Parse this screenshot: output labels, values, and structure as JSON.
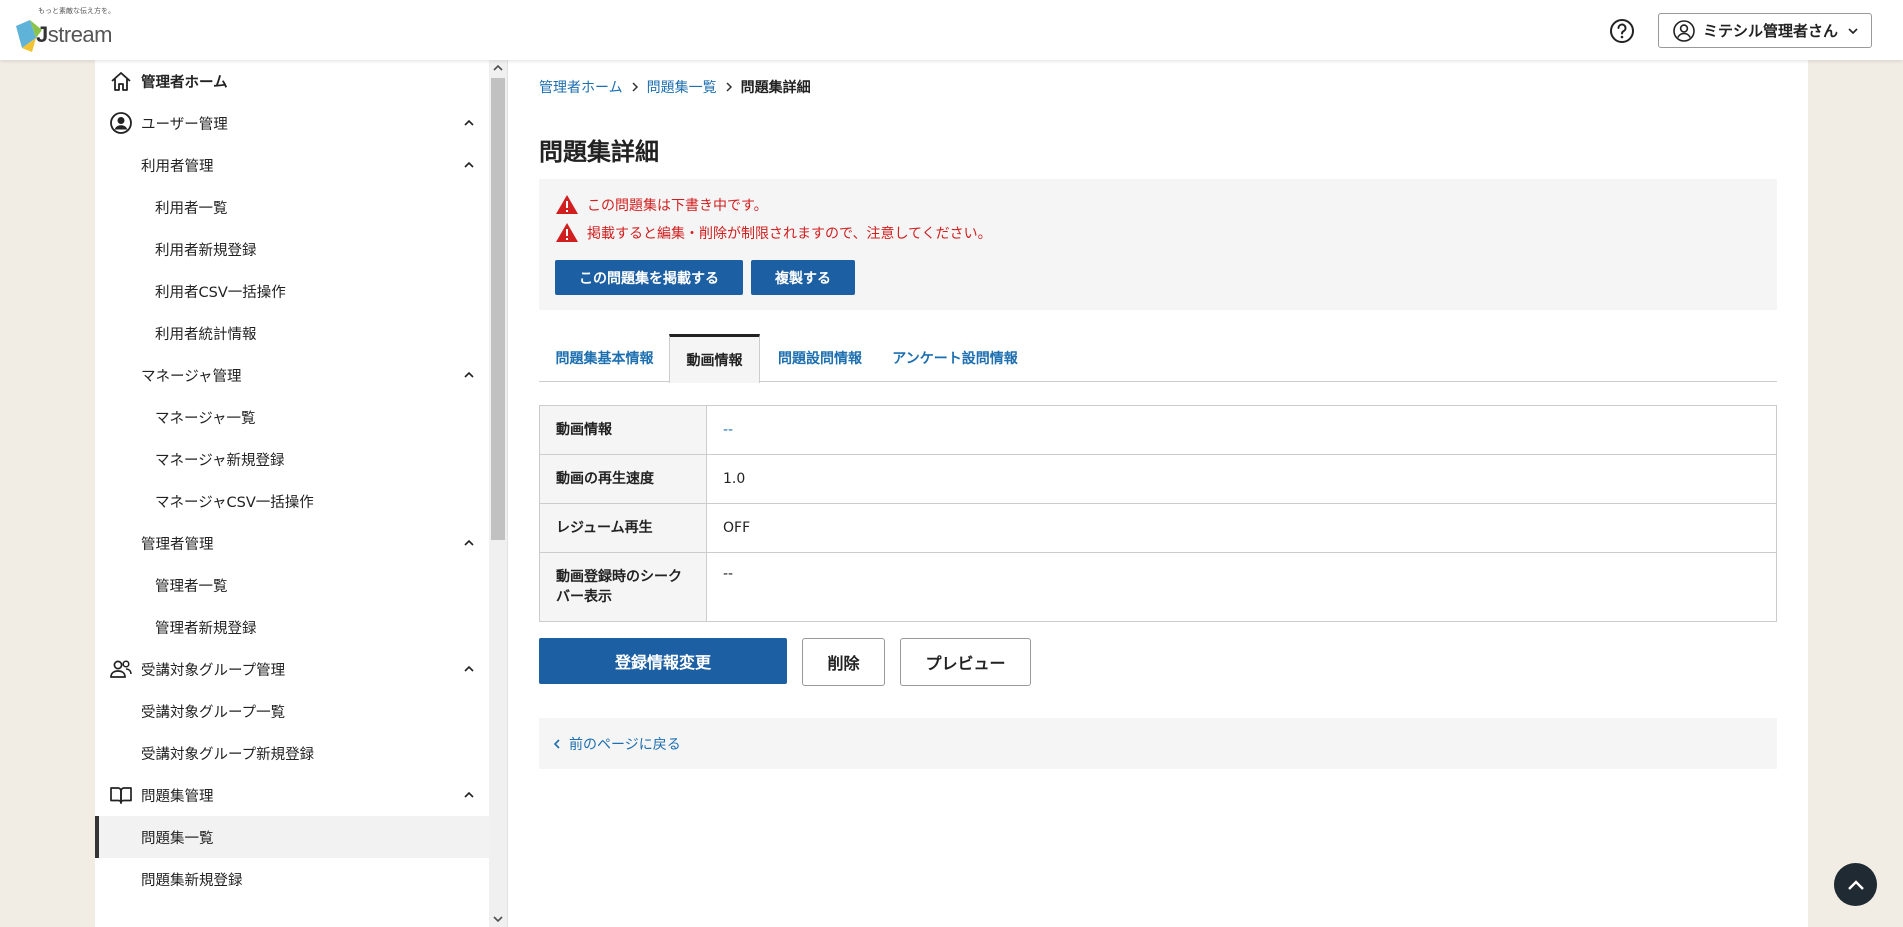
{
  "header": {
    "logo_tagline": "もっと素敵な伝え方を。",
    "logo_text": "stream",
    "logo_letter": "J",
    "user_label": "ミテシル管理者さん"
  },
  "sidebar": {
    "items": [
      {
        "label": "管理者ホーム"
      },
      {
        "label": "ユーザー管理"
      },
      {
        "label": "利用者管理"
      },
      {
        "label": "利用者一覧"
      },
      {
        "label": "利用者新規登録"
      },
      {
        "label": "利用者CSV一括操作"
      },
      {
        "label": "利用者統計情報"
      },
      {
        "label": "マネージャ管理"
      },
      {
        "label": "マネージャ一覧"
      },
      {
        "label": "マネージャ新規登録"
      },
      {
        "label": "マネージャCSV一括操作"
      },
      {
        "label": "管理者管理"
      },
      {
        "label": "管理者一覧"
      },
      {
        "label": "管理者新規登録"
      },
      {
        "label": "受講対象グループ管理"
      },
      {
        "label": "受講対象グループ一覧"
      },
      {
        "label": "受講対象グループ新規登録"
      },
      {
        "label": "問題集管理"
      },
      {
        "label": "問題集一覧"
      },
      {
        "label": "問題集新規登録"
      }
    ]
  },
  "breadcrumb": {
    "home": "管理者ホーム",
    "list": "問題集一覧",
    "current": "問題集詳細"
  },
  "page": {
    "title": "問題集詳細"
  },
  "alert": {
    "line1": "この問題集は下書き中です。",
    "line2": "掲載すると編集・削除が制限されますので、注意してください。",
    "publish_button": "この問題集を掲載する",
    "duplicate_button": "複製する"
  },
  "tabs": [
    {
      "label": "問題集基本情報"
    },
    {
      "label": "動画情報"
    },
    {
      "label": "問題設問情報"
    },
    {
      "label": "アンケート設問情報"
    }
  ],
  "table": {
    "rows": [
      {
        "label": "動画情報",
        "value": "--"
      },
      {
        "label": "動画の再生速度",
        "value": "1.0"
      },
      {
        "label": "レジューム再生",
        "value": "OFF"
      },
      {
        "label": "動画登録時のシークバー表示",
        "value": "--"
      }
    ]
  },
  "actions": {
    "edit": "登録情報変更",
    "delete": "削除",
    "preview": "プレビュー",
    "back": "前のページに戻る"
  },
  "colors": {
    "primary": "#1d5fa3",
    "link": "#1d6fb0",
    "warning": "#d11f1f",
    "page_bg": "#f2ede4"
  }
}
